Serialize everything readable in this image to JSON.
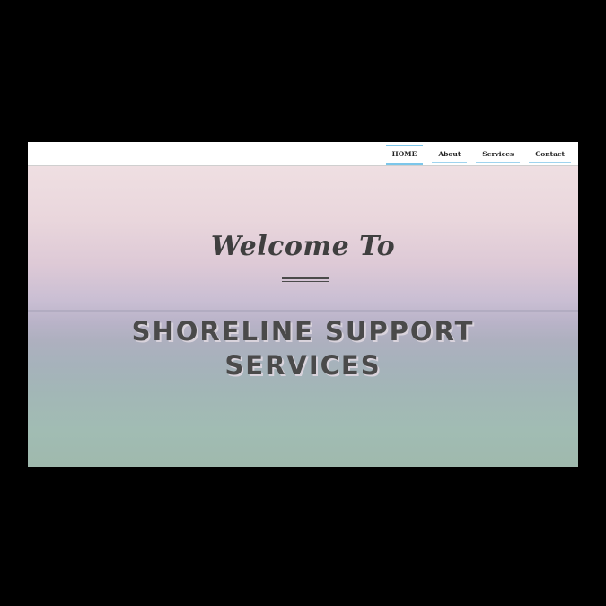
{
  "nav": {
    "items": [
      {
        "label": "HOME",
        "active": true
      },
      {
        "label": "About",
        "active": false
      },
      {
        "label": "Services",
        "active": false
      },
      {
        "label": "Contact",
        "active": false
      }
    ],
    "accent_color": "#7cc6ea"
  },
  "hero": {
    "welcome": "Welcome To",
    "title_line1": "SHORELINE SUPPORT",
    "title_line2": "SERVICES",
    "text_color": "#4a4a4a"
  }
}
